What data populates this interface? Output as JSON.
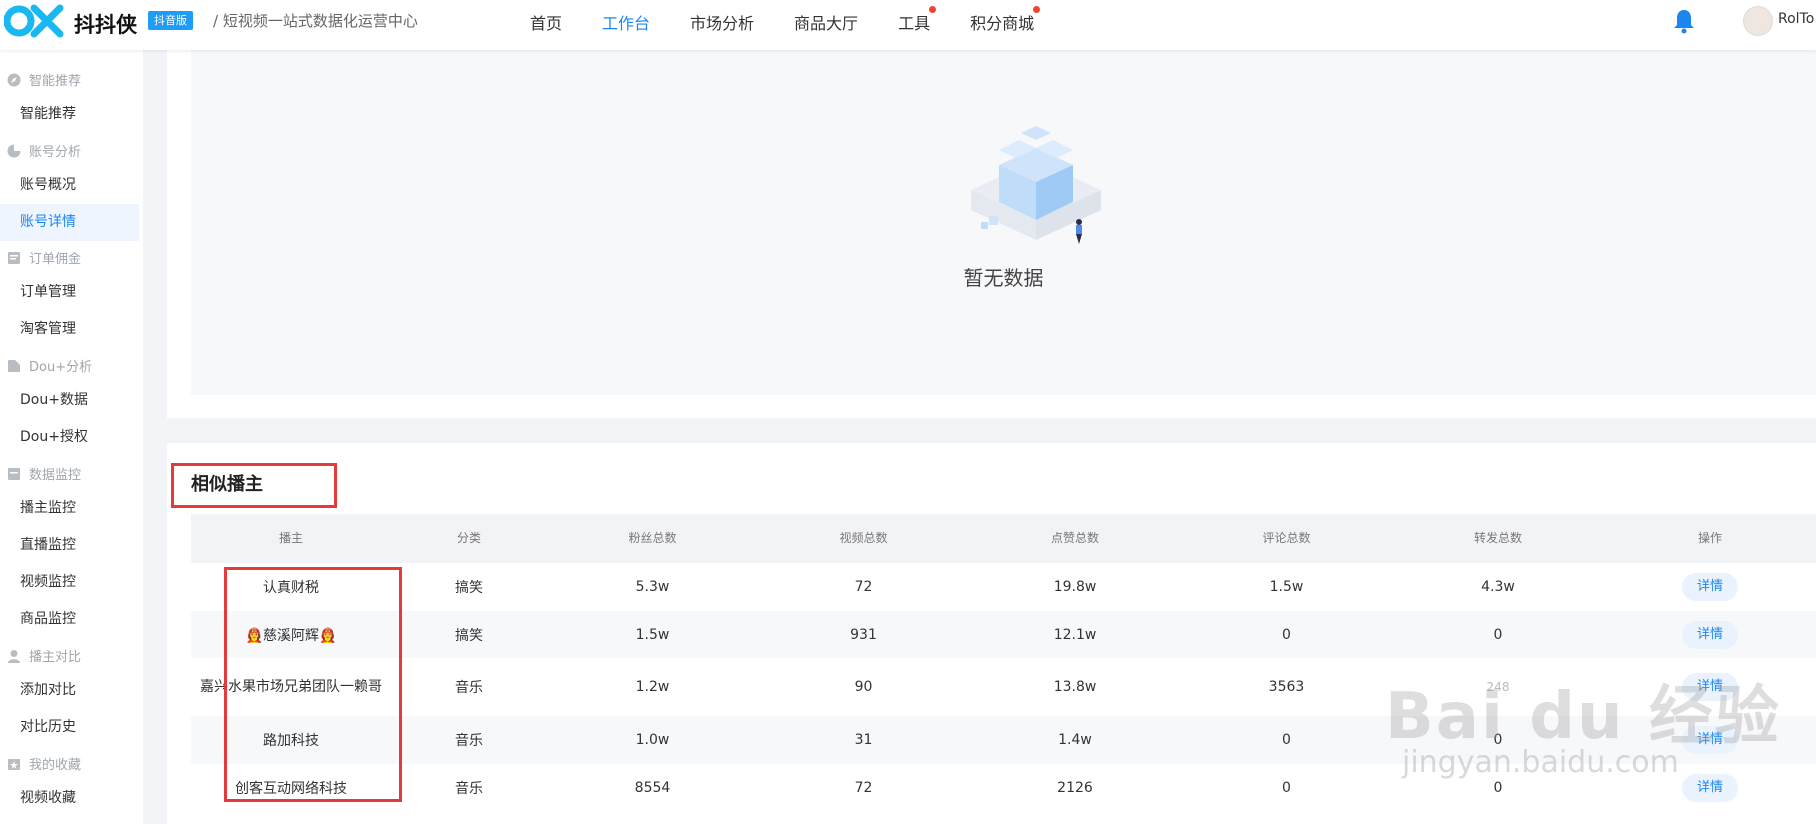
{
  "header": {
    "brand": "抖抖侠",
    "badge": "抖音版",
    "tagline": "/  短视频一站式数据化运营中心",
    "nav": [
      {
        "label": "首页",
        "active": false,
        "dot": false
      },
      {
        "label": "工作台",
        "active": true,
        "dot": false
      },
      {
        "label": "市场分析",
        "active": false,
        "dot": false
      },
      {
        "label": "商品大厅",
        "active": false,
        "dot": false
      },
      {
        "label": "工具",
        "active": false,
        "dot": true
      },
      {
        "label": "积分商城",
        "active": false,
        "dot": true
      }
    ],
    "username": "RolTo"
  },
  "sidebar": {
    "groups": [
      {
        "label": "智能推荐",
        "icon": "compass-icon",
        "items": [
          {
            "label": "智能推荐",
            "active": false
          }
        ]
      },
      {
        "label": "账号分析",
        "icon": "pie-chart-icon",
        "items": [
          {
            "label": "账号概况",
            "active": false
          },
          {
            "label": "账号详情",
            "active": true
          }
        ]
      },
      {
        "label": "订单佣金",
        "icon": "order-icon",
        "items": [
          {
            "label": "订单管理",
            "active": false
          },
          {
            "label": "淘客管理",
            "active": false
          }
        ]
      },
      {
        "label": "Dou+分析",
        "icon": "bookmark-icon",
        "items": [
          {
            "label": "Dou+数据",
            "active": false
          },
          {
            "label": "Dou+授权",
            "active": false
          }
        ]
      },
      {
        "label": "数据监控",
        "icon": "monitor-icon",
        "items": [
          {
            "label": "播主监控",
            "active": false
          },
          {
            "label": "直播监控",
            "active": false
          },
          {
            "label": "视频监控",
            "active": false
          },
          {
            "label": "商品监控",
            "active": false
          }
        ]
      },
      {
        "label": "播主对比",
        "icon": "user-icon",
        "items": [
          {
            "label": "添加对比",
            "active": false
          },
          {
            "label": "对比历史",
            "active": false
          }
        ]
      },
      {
        "label": "我的收藏",
        "icon": "star-folder-icon",
        "items": [
          {
            "label": "视频收藏",
            "active": false
          }
        ]
      }
    ]
  },
  "empty_state": {
    "text": "暂无数据"
  },
  "similar": {
    "title": "相似播主",
    "columns": [
      "播主",
      "分类",
      "粉丝总数",
      "视频总数",
      "点赞总数",
      "评论总数",
      "转发总数",
      "操作"
    ],
    "rows": [
      {
        "name": "认真财税",
        "category": "搞笑",
        "fans": "5.3w",
        "videos": "72",
        "likes": "19.8w",
        "comments": "1.5w",
        "shares": "4.3w",
        "action": "详情"
      },
      {
        "name": "👩‍🚒慈溪阿辉👩‍🚒",
        "category": "搞笑",
        "fans": "1.5w",
        "videos": "931",
        "likes": "12.1w",
        "comments": "0",
        "shares": "0",
        "action": "详情"
      },
      {
        "name": "嘉兴水果市场兄弟团队一赖哥",
        "category": "音乐",
        "fans": "1.2w",
        "videos": "90",
        "likes": "13.8w",
        "comments": "3563",
        "shares": "248",
        "action": "详情"
      },
      {
        "name": "路加科技",
        "category": "音乐",
        "fans": "1.0w",
        "videos": "31",
        "likes": "1.4w",
        "comments": "0",
        "shares": "0",
        "action": "详情"
      },
      {
        "name": "创客互动网络科技",
        "category": "音乐",
        "fans": "8554",
        "videos": "72",
        "likes": "2126",
        "comments": "0",
        "shares": "0",
        "action": "详情"
      }
    ]
  },
  "watermark": {
    "main": "Bai du 经验",
    "sub": "jingyan.baidu.com"
  },
  "colors": {
    "accent": "#1b86f0",
    "highlight": "#e43a3a",
    "badge": "#1e9cf6"
  }
}
